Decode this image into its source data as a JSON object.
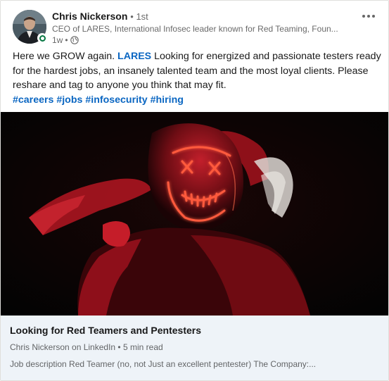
{
  "post": {
    "author": {
      "name": "Chris Nickerson",
      "degree": "1st",
      "headline": "CEO of LARES, International Infosec leader known for Red Teaming, Foun...",
      "time": "1w",
      "visibility_icon": "globe-icon",
      "presence_status": "online"
    },
    "overflow_icon": "more-horizontal-icon",
    "text": {
      "intro": "Here we GROW again.",
      "mention": "LARES",
      "body": "Looking for energized and passionate testers ready for the hardest jobs, an insanely talented team and the most loyal clients. Please reshare and tag to anyone you think that may fit.",
      "hashtags": [
        "#careers",
        "#jobs",
        "#infosecurity",
        "#hiring"
      ]
    },
    "article": {
      "title": "Looking for Red Teamers and Pentesters",
      "source": "Chris Nickerson on LinkedIn",
      "read_time": "5 min read",
      "description": "Job description Red Teamer (no, not Just an excellent pentester) The Company:..."
    }
  },
  "colors": {
    "link": "#0a66c2",
    "presence": "#057642",
    "article_bg": "#eef3f8",
    "image_accent": "#e8323c",
    "mask_glow": "#ff5a3c"
  }
}
